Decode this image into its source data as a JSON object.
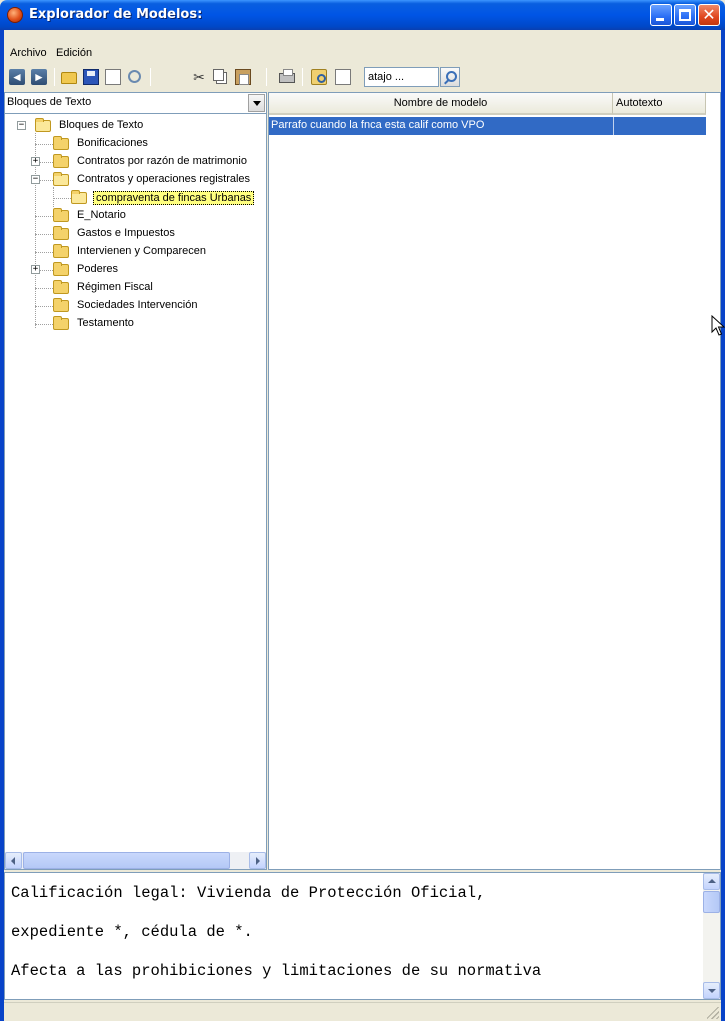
{
  "window": {
    "title": "Explorador de Modelos:"
  },
  "menu": {
    "items": [
      "Archivo",
      "Edición"
    ]
  },
  "toolbar": {
    "shortcut_value": "atajo ...",
    "icons": [
      "back-icon",
      "forward-icon",
      "open-folder-icon",
      "save-icon",
      "new-document-icon",
      "refresh-icon",
      "cut-icon",
      "copy-icon",
      "paste-icon",
      "print-icon",
      "find-icon",
      "find-document-icon",
      "search-icon"
    ]
  },
  "tree": {
    "selector_value": "Bloques de Texto",
    "nodes": [
      {
        "label": "Bloques de Texto",
        "expander": "−"
      },
      {
        "label": "Bonificaciones"
      },
      {
        "label": "Contratos por razón de matrimonio",
        "expander": "+"
      },
      {
        "label": "Contratos y operaciones registrales",
        "expander": "−"
      },
      {
        "label": "compraventa de fincas Urbanas"
      },
      {
        "label": "E_Notario"
      },
      {
        "label": "Gastos e Impuestos"
      },
      {
        "label": "Intervienen y Comparecen"
      },
      {
        "label": "Poderes",
        "expander": "+"
      },
      {
        "label": "Régimen Fiscal"
      },
      {
        "label": "Sociedades Intervención"
      },
      {
        "label": "Testamento"
      }
    ]
  },
  "table": {
    "columns": [
      "Nombre de modelo",
      "Autotexto"
    ],
    "rows": [
      {
        "name": "Parrafo cuando la fnca esta calif como VPO",
        "autotext": ""
      }
    ]
  },
  "preview": {
    "lines": [
      "Calificación legal: Vivienda de Protección Oficial,",
      "expediente *, cédula de *.",
      "Afecta a las prohibiciones y limitaciones de su normativa"
    ]
  },
  "colors": {
    "title_bar": "#0055e5",
    "selection": "#316ac5",
    "selected_node": "#ffff80"
  }
}
